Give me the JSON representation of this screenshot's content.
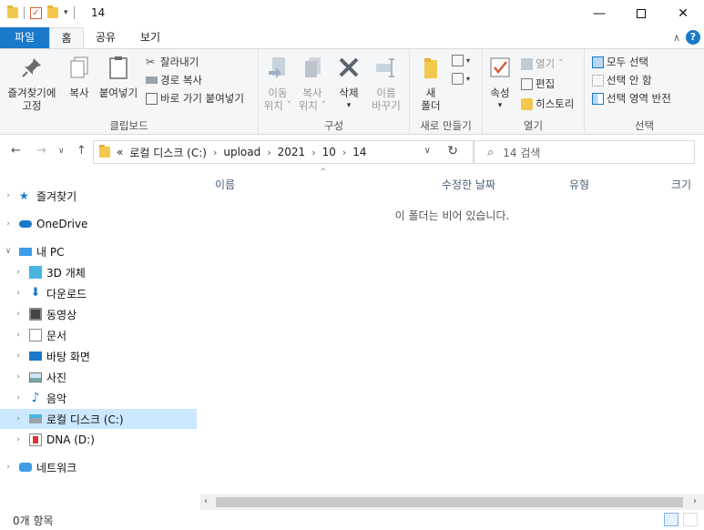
{
  "window": {
    "title": "14"
  },
  "tabs": {
    "file": "파일",
    "home": "홈",
    "share": "공유",
    "view": "보기"
  },
  "ribbon": {
    "clipboard": {
      "pin": "즐겨찾기에\n고정",
      "copy": "복사",
      "paste": "붙여넣기",
      "cut": "잘라내기",
      "copy_path": "경로 복사",
      "paste_shortcut": "바로 가기 붙여넣기",
      "label": "클립보드"
    },
    "organize": {
      "move": "이동\n위치 ˇ",
      "copy_to": "복사\n위치 ˇ",
      "delete": "삭제",
      "rename": "이름\n바꾸기",
      "label": "구성"
    },
    "new": {
      "new_folder": "새\n폴더",
      "label": "새로 만들기"
    },
    "open": {
      "properties": "속성",
      "open": "열기 ˇ",
      "edit": "편집",
      "history": "히스토리",
      "label": "열기"
    },
    "select": {
      "select_all": "모두 선택",
      "select_none": "선택 안 함",
      "invert": "선택 영역 반전",
      "label": "선택"
    }
  },
  "address": {
    "prefix": "«",
    "crumbs": [
      "로컬 디스크 (C:)",
      "upload",
      "2021",
      "10",
      "14"
    ],
    "search_placeholder": "14 검색"
  },
  "nav": {
    "favorites": "즐겨찾기",
    "onedrive": "OneDrive",
    "thispc": "내 PC",
    "objects3d": "3D 개체",
    "downloads": "다운로드",
    "videos": "동영상",
    "documents": "문서",
    "desktop": "바탕 화면",
    "pictures": "사진",
    "music": "음악",
    "local_c": "로컬 디스크 (C:)",
    "dna_d": "DNA (D:)",
    "network": "네트워크"
  },
  "columns": {
    "name": "이름",
    "modified": "수정한 날짜",
    "type": "유형",
    "size": "크기"
  },
  "empty_message": "이 폴더는 비어 있습니다.",
  "status": {
    "items": "0개 항목"
  },
  "colors": {
    "accent": "#1979ca",
    "selected": "#cce8ff",
    "folder": "#f2c94c"
  }
}
